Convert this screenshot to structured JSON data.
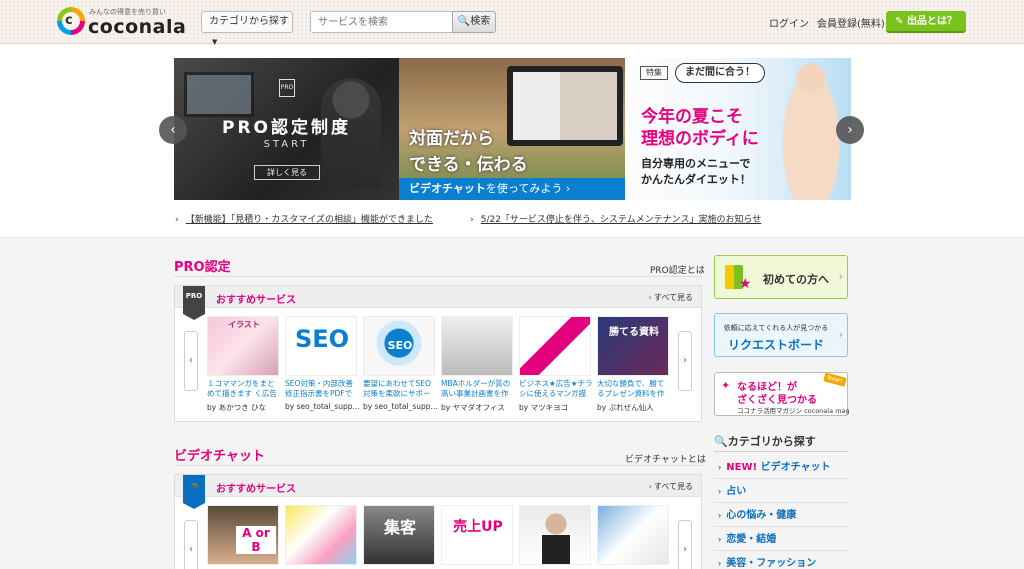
{
  "header": {
    "logo_tagline": "みんなの得意を売り買い",
    "logo_text": "coconala",
    "logo_mark": "c",
    "category_button": "カテゴリから探す",
    "search_placeholder": "サービスを検索",
    "search_button": "検索",
    "login": "ログイン",
    "register": "会員登録(無料)",
    "sell_button": "出品とは？"
  },
  "hero": {
    "slide1": {
      "badge": "PRO",
      "title": "PRO認定制度",
      "subtitle": "START",
      "detail": "詳しく見る"
    },
    "slide2": {
      "line1": "対面だから",
      "line2": "できる・伝わる",
      "bar_bold": "ビデオチャット",
      "bar_rest": "を使ってみよう ›"
    },
    "slide3": {
      "tag": "特集",
      "bubble": "まだ間に合う！",
      "line1": "今年の夏こそ",
      "line2": "理想のボディに",
      "line3": "自分専用のメニューで",
      "line4": "かんたんダイエット！"
    },
    "prev": "‹",
    "next": "›",
    "news": [
      {
        "text": "【新機能】「見積り・カスタマイズの相談」機能ができました"
      },
      {
        "text": "5/22「サービス停止を伴う、システムメンテナンス」実施のお知らせ"
      }
    ]
  },
  "pro_section": {
    "title": "PRO認定",
    "link": "PRO認定とは",
    "ribbon": "PRO",
    "panel_label": "おすすめサービス",
    "more": "すべて見る",
    "items": [
      {
        "thumb": "イラスト",
        "desc": "１コママンガをまとめて描きます く広告や",
        "by": "by あかつき ひな"
      },
      {
        "thumb": "SEO",
        "desc": "SEO対策・内部改善修正指示書をPDFで納",
        "by": "by seo_total_supp…"
      },
      {
        "thumb": "SEO",
        "desc": "要望にあわせてSEO対策を柔軟にサポート",
        "by": "by seo_total_supp…"
      },
      {
        "thumb": "",
        "desc": "MBAホルダーが質の高い事業計画書を作成",
        "by": "by ヤマダオフィス"
      },
      {
        "thumb": "",
        "desc": "ビジネス★広告★チラシに使えるマンガ描き",
        "by": "by マツキヨコ"
      },
      {
        "thumb": "勝てる資料",
        "desc": "大切な勝負で、勝てるプレゼン資料を作成",
        "by": "by ぷれぜん仙人"
      }
    ]
  },
  "video_section": {
    "title": "ビデオチャット",
    "link": "ビデオチャットとは",
    "ribbon": "📹",
    "panel_label": "おすすめサービス",
    "more": "すべて見る",
    "items": [
      {
        "thumb": "A or B"
      },
      {
        "thumb": ""
      },
      {
        "thumb": "集客"
      },
      {
        "thumb": "売上UP"
      },
      {
        "thumb": ""
      },
      {
        "thumb": ""
      }
    ]
  },
  "sidebar": {
    "first_time": "初めての方へ",
    "request_small": "依頼に応えてくれる人が見つかる",
    "request_label": "リクエストボード",
    "mag_l1": "なるほど！が",
    "mag_l2": "ざくざく見つかる",
    "mag_l3": "ココナラ活用マガジン coconala mag",
    "mag_new": "New!",
    "category_heading": "カテゴリから探す",
    "categories": [
      {
        "new": "NEW!",
        "label": "ビデオチャット"
      },
      {
        "new": "",
        "label": "占い"
      },
      {
        "new": "",
        "label": "心の悩み・健康"
      },
      {
        "new": "",
        "label": "恋愛・結婚"
      },
      {
        "new": "",
        "label": "美容・ファッション"
      }
    ]
  },
  "colors": {
    "brand_pink": "#e4007f",
    "brand_green": "#7ac21e",
    "link_blue": "#0a7fd0"
  }
}
